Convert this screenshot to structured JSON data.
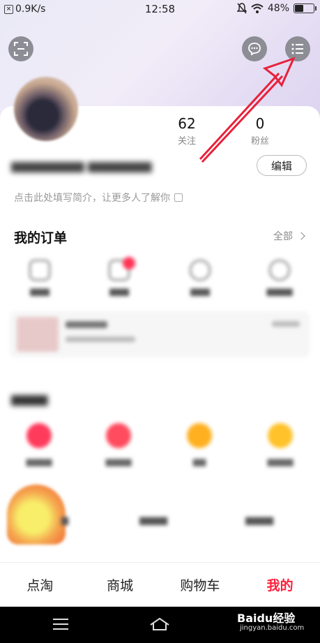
{
  "status_bar": {
    "speed": "0.9K/s",
    "time": "12:58",
    "battery": "48%",
    "battery_fraction": 0.48
  },
  "profile": {
    "stats": [
      {
        "num": "",
        "label": ""
      },
      {
        "num": "62",
        "label": "关注"
      },
      {
        "num": "0",
        "label": "粉丝"
      }
    ],
    "edit_label": "编辑",
    "bio_placeholder": "点击此处填写简介，让更多人了解你"
  },
  "orders": {
    "title": "我的订单",
    "all_label": "全部"
  },
  "tabbar": {
    "tabs": [
      "点淘",
      "商城",
      "购物车",
      "我的"
    ],
    "active_index": 3
  },
  "watermark": {
    "brand": "Baidu经验",
    "url": "jingyan.baidu.com"
  },
  "colors": {
    "accent": "#ff1e3c",
    "annotation_arrow": "#e8213a"
  },
  "icons": {
    "scan": "scan-icon",
    "chat": "chat-icon",
    "menu": "menu-list-icon"
  }
}
